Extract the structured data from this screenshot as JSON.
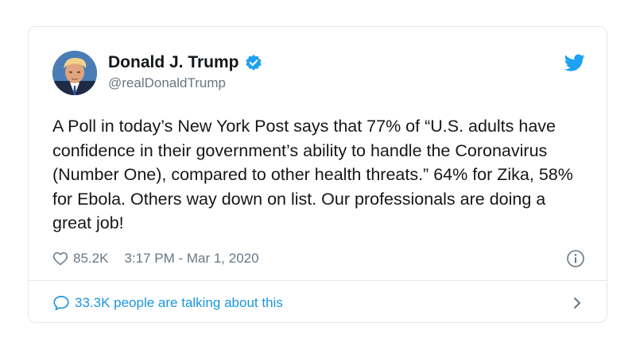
{
  "user": {
    "display_name": "Donald J. Trump",
    "handle": "@realDonaldTrump"
  },
  "tweet": {
    "text": "A Poll in today’s New York Post says that 77% of “U.S. adults have confidence in their government’s ability to handle the Coronavirus (Number One), compared to other health threats.” 64% for Zika, 58% for Ebola. Others way down on list. Our professionals are doing a great job!",
    "likes": "85.2K",
    "timestamp": "3:17 PM - Mar 1, 2020"
  },
  "footer": {
    "talking_label": "33.3K people are talking about this"
  },
  "icons": {
    "verified": "verified-badge-icon",
    "logo": "twitter-bird-icon",
    "like": "heart-icon",
    "info": "info-icon",
    "reply": "speech-bubble-icon",
    "more": "chevron-right-icon"
  },
  "colors": {
    "accent": "#1da1f2",
    "link": "#1b95e0",
    "muted": "#657786",
    "text": "#14171a",
    "border": "#e1e8ed"
  }
}
